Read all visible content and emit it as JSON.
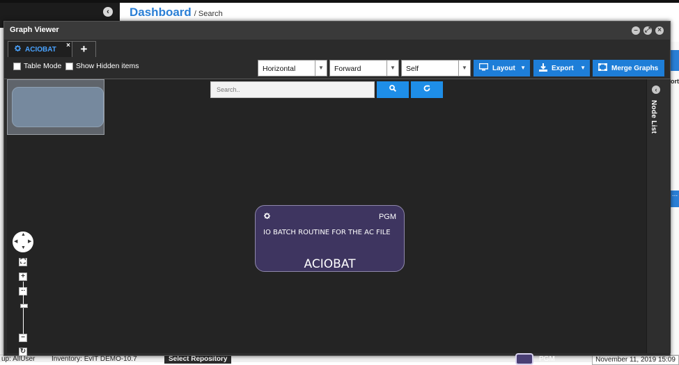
{
  "background": {
    "breadcrumb_main": "Dashboard",
    "breadcrumb_sub": "/ Search",
    "right_text": "ort",
    "right_more": "...",
    "status_group": "up: AllUser",
    "status_inventory": "Inventory: EvIT DEMO-10.7",
    "status_repo": "Select Repository",
    "status_date": "November 11, 2019 15:09"
  },
  "dialog": {
    "title": "Graph Viewer",
    "tab_label": "ACIOBAT",
    "tab_close": "×",
    "add_tab": "+"
  },
  "toolbar": {
    "table_mode": "Table Mode",
    "show_hidden": "Show Hidden items",
    "orientation": "Horizontal",
    "direction": "Forward",
    "scope": "Self",
    "layout_label": "Layout",
    "export_label": "Export",
    "merge_label": "Merge Graphs"
  },
  "search": {
    "placeholder": "Search.."
  },
  "node_list": {
    "label": "Node List"
  },
  "graph_node": {
    "type": "PGM",
    "description": "IO BATCH ROUTINE FOR THE AC FILE",
    "name": "ACIOBAT"
  },
  "legend": {
    "label": "PGM",
    "color": "#4a3f74"
  },
  "colors": {
    "accent": "#1e7ed8",
    "node_fill": "#3e3560",
    "tab_text": "#4aa3ff"
  }
}
